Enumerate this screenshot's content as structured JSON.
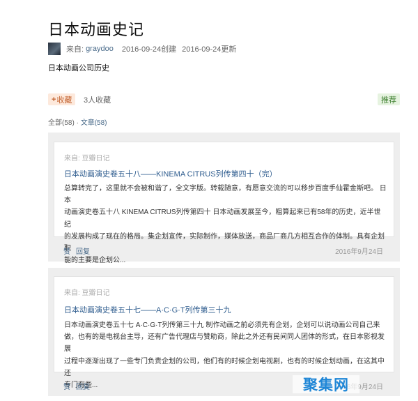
{
  "page": {
    "title": "日本动画史记",
    "author_label": "来自:",
    "author_name": "graydoo",
    "created": "2016-09-24创建",
    "updated": "2016-09-24更新",
    "description": "日本动画公司历史"
  },
  "actions": {
    "collect_plus": "+",
    "collect_label": "收藏",
    "collect_count": "3人收藏",
    "recommend_label": "推荐"
  },
  "filter": {
    "all": "全部(58)",
    "separator": "·",
    "articles": "文章(58)"
  },
  "posts": [
    {
      "source": "来自: 豆瓣日记",
      "title": "日本动画演史卷五十八——KINEMA CITRUS列传第四十（完）",
      "lines": [
        "总算转完了，这里就不会被和谐了，全文字版。转载随意，有愿意交流的可以移步百度手仙霍金斯吧。 日本",
        "动画演史卷五十八 KINEMA CITRUS列传第四十 日本动画发展至今，粗算起来已有58年的历史，近半世纪",
        "的发展构成了现在的格局。集企划宣传，实际制作，媒体放送，商品厂商几方相互合作的体制。具有企划职",
        "能的主要是企划公..."
      ],
      "like": "赞",
      "reply": "回复",
      "date": "2016年9月24日"
    },
    {
      "source": "来自: 豆瓣日记",
      "title": "日本动画演史卷五十七——A·C·G·T列传第三十九",
      "lines": [
        "日本动画演史卷五十七 A·C·G·T列传第三十九 制作动画之前必须先有企划，企划可以说动画公司自己来",
        "做，也有的是电视台主导，还有广告代理店与赞助商，除此之外还有民间同人团体的形式，在日本影视发展",
        "过程中逐渐出现了一些专门负责企划的公司，他们有的时候企划电视剧，也有的时候企划动画，在这其中还",
        "专门有些..."
      ],
      "like": "赞",
      "reply": "回复",
      "date": "2016年9月24日"
    }
  ],
  "watermark": "聚集网"
}
